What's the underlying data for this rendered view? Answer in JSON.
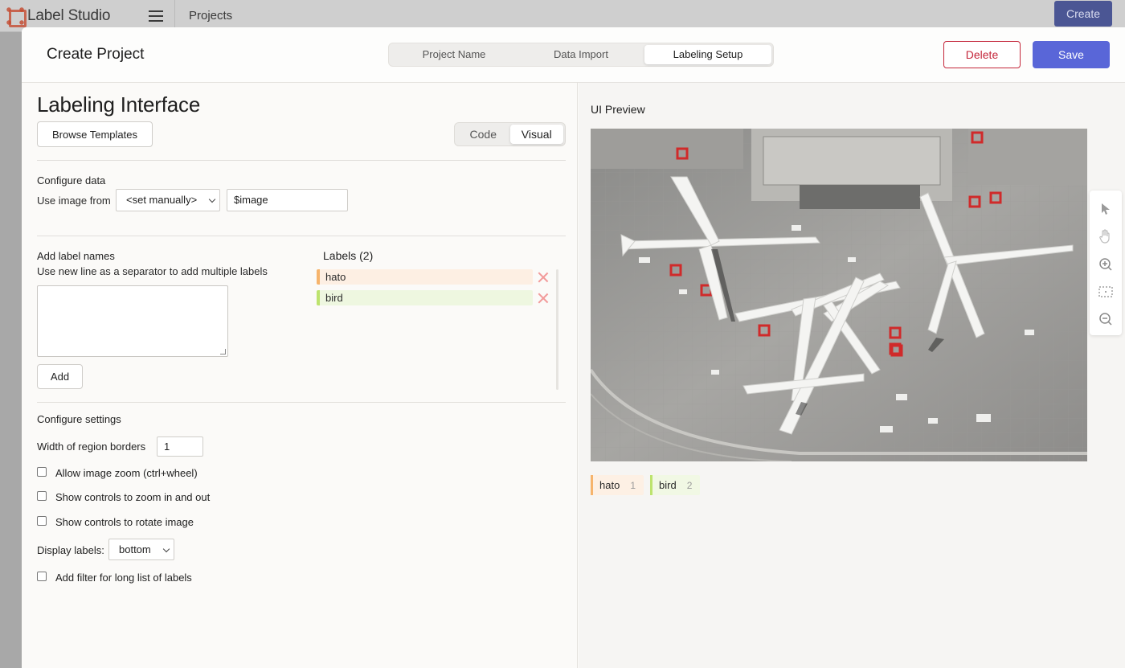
{
  "app": {
    "name": "Label Studio",
    "breadcrumb": "Projects",
    "create_label": "Create"
  },
  "modal": {
    "title": "Create Project",
    "steps": [
      "Project Name",
      "Data Import",
      "Labeling Setup"
    ],
    "active_step": "Labeling Setup",
    "delete_label": "Delete",
    "save_label": "Save"
  },
  "editor": {
    "heading": "Labeling Interface",
    "browse_label": "Browse Templates",
    "modes": [
      "Code",
      "Visual"
    ],
    "active_mode": "Visual",
    "configure_data": {
      "title": "Configure data",
      "use_image_label": "Use image from",
      "source_value": "<set manually>",
      "field_value": "$image"
    },
    "add_labels": {
      "title": "Add label names",
      "hint": "Use new line as a separator to add multiple labels",
      "textarea_value": "",
      "add_label": "Add"
    },
    "labels": {
      "heading": "Labels (2)",
      "items": [
        {
          "name": "hato",
          "color": "#f6b46c"
        },
        {
          "name": "bird",
          "color": "#bde36e"
        }
      ]
    },
    "settings": {
      "title": "Configure settings",
      "border_width_label": "Width of region borders",
      "border_width_value": "1",
      "zoom_label": "Allow image zoom (ctrl+wheel)",
      "zoom_controls_label": "Show controls to zoom in and out",
      "rotate_label": "Show controls to rotate image",
      "display_labels_label": "Display labels:",
      "display_labels_value": "bottom",
      "filter_label": "Add filter for long list of labels"
    }
  },
  "preview": {
    "title": "UI Preview",
    "legend": [
      {
        "name": "hato",
        "hotkey": "1"
      },
      {
        "name": "bird",
        "hotkey": "2"
      }
    ]
  },
  "colors": {
    "accent": "#5966d8",
    "danger": "#c4263a"
  }
}
